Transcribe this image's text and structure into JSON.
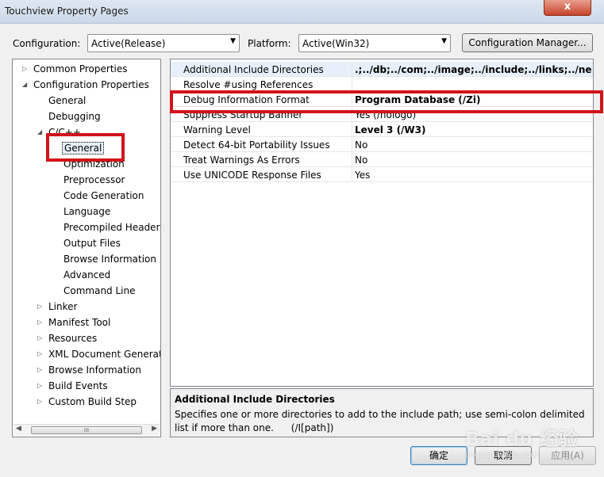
{
  "window": {
    "title": "Touchview Property Pages",
    "close": "x"
  },
  "toolbar": {
    "configuration_label": "Configuration:",
    "configuration_value": "Active(Release)",
    "platform_label": "Platform:",
    "platform_value": "Active(Win32)",
    "config_manager": "Configuration Manager..."
  },
  "tree": {
    "common_properties": "Common Properties",
    "configuration_properties": "Configuration Properties",
    "general": "General",
    "debugging": "Debugging",
    "cpp": "C/C++",
    "cpp_general": "General",
    "optimization": "Optimization",
    "preprocessor": "Preprocessor",
    "code_generation": "Code Generation",
    "language": "Language",
    "precompiled_headers": "Precompiled Header",
    "output_files": "Output Files",
    "browse_information_cpp": "Browse Information",
    "advanced": "Advanced",
    "command_line": "Command Line",
    "linker": "Linker",
    "manifest_tool": "Manifest Tool",
    "resources": "Resources",
    "xml_document_generator": "XML Document Generat",
    "browse_information": "Browse Information",
    "build_events": "Build Events",
    "custom_build_step": "Custom Build Step",
    "scroll_grip": "III"
  },
  "properties": [
    {
      "name": "Additional Include Directories",
      "value": ".;../db;../com;../image;../include;../links;../net;../use",
      "bold": true
    },
    {
      "name": "Resolve #using References",
      "value": "",
      "bold": false
    },
    {
      "name": "Debug Information Format",
      "value": "Program Database (/Zi)",
      "bold": true
    },
    {
      "name": "Suppress Startup Banner",
      "value": "Yes (/nologo)",
      "bold": false
    },
    {
      "name": "Warning Level",
      "value": "Level 3 (/W3)",
      "bold": true
    },
    {
      "name": "Detect 64-bit Portability Issues",
      "value": "No",
      "bold": false
    },
    {
      "name": "Treat Warnings As Errors",
      "value": "No",
      "bold": false
    },
    {
      "name": "Use UNICODE Response Files",
      "value": "Yes",
      "bold": false
    }
  ],
  "description": {
    "title": "Additional Include Directories",
    "text": "Specifies one or more directories to add to the include path; use semi-colon delimited list if more than one.",
    "switch": "(/I[path])"
  },
  "buttons": {
    "ok": "确定",
    "cancel": "取消",
    "apply": "应用(A)"
  },
  "watermark": {
    "text": "Bai du 经验",
    "sub": "jingyan.baidu.com"
  },
  "colors": {
    "highlight": "#d3131c",
    "selection": "#e7f0fa"
  }
}
